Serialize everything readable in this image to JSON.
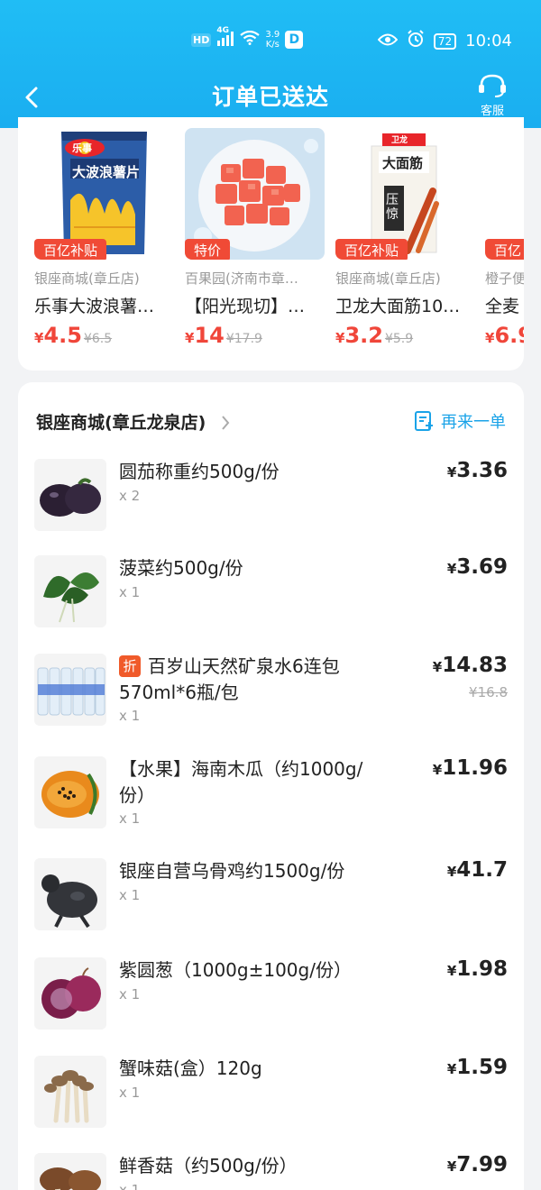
{
  "status_bar": {
    "hd": "HD",
    "signal": "4G",
    "net_speed_value": "3.9",
    "net_speed_unit": "K/s",
    "app_badge": "D",
    "battery": "72",
    "time": "10:04"
  },
  "nav": {
    "title": "订单已送达",
    "service_label": "客服"
  },
  "recommendations": [
    {
      "tag": "百亿补贴",
      "store": "银座商城(章丘店)",
      "name": "乐事大波浪薯…",
      "yen": "¥",
      "price": "4.5",
      "original": "¥6.5"
    },
    {
      "tag": "特价",
      "store": "百果园(济南市章…",
      "name": "【阳光现切】…",
      "yen": "¥",
      "price": "14",
      "original": "¥17.9"
    },
    {
      "tag": "百亿补贴",
      "store": "银座商城(章丘店)",
      "name": "卫龙大面筋10…",
      "yen": "¥",
      "price": "3.2",
      "original": "¥5.9"
    },
    {
      "tag": "百亿",
      "store": "橙子便",
      "name": "全麦",
      "yen": "¥",
      "price": "6.9",
      "original": ""
    }
  ],
  "order": {
    "store_name": "银座商城(章丘龙泉店)",
    "reorder_label": "再来一单",
    "discount_badge": "折",
    "items": [
      {
        "name": "圆茄称重约500g/份",
        "qty": "x 2",
        "yen": "¥",
        "price": "3.36",
        "original": ""
      },
      {
        "name": "菠菜约500g/份",
        "qty": "x 1",
        "yen": "¥",
        "price": "3.69",
        "original": ""
      },
      {
        "name": "百岁山天然矿泉水6连包570ml*6瓶/包",
        "qty": "x 1",
        "yen": "¥",
        "price": "14.83",
        "original": "¥16.8"
      },
      {
        "name": "【水果】海南木瓜（约1000g/份）",
        "qty": "x 1",
        "yen": "¥",
        "price": "11.96",
        "original": ""
      },
      {
        "name": "银座自营乌骨鸡约1500g/份",
        "qty": "x 1",
        "yen": "¥",
        "price": "41.7",
        "original": ""
      },
      {
        "name": "紫圆葱（1000g±100g/份）",
        "qty": "x 1",
        "yen": "¥",
        "price": "1.98",
        "original": ""
      },
      {
        "name": "蟹味菇(盒）120g",
        "qty": "x 1",
        "yen": "¥",
        "price": "1.59",
        "original": ""
      },
      {
        "name": "鲜香菇（约500g/份）",
        "qty": "x 1",
        "yen": "¥",
        "price": "7.99",
        "original": ""
      }
    ]
  },
  "product_images": {
    "chips_brand": "乐事",
    "chips_title": "大波浪薯片",
    "noodle_brand": "卫龙",
    "noodle_title": "大面筋",
    "noodle_sub": "压惊"
  },
  "colors": {
    "header": "#1aaef0",
    "accent": "#1aa3e8",
    "price_red": "#f0463a",
    "tag_red": "#f04a36"
  }
}
